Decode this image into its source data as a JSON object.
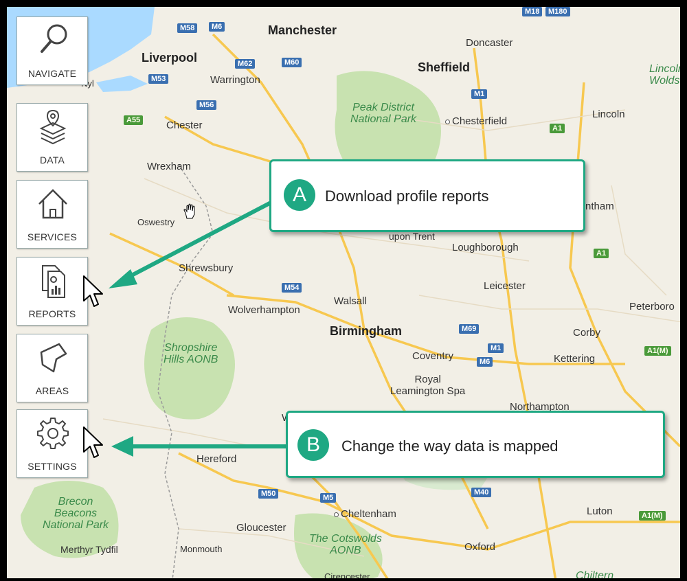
{
  "sidebar": {
    "items": [
      {
        "label": "NAVIGATE",
        "icon": "magnifier-icon"
      },
      {
        "label": "DATA",
        "icon": "layers-pin-icon"
      },
      {
        "label": "SERVICES",
        "icon": "house-icon"
      },
      {
        "label": "REPORTS",
        "icon": "report-document-icon"
      },
      {
        "label": "AREAS",
        "icon": "polygon-icon"
      },
      {
        "label": "SETTINGS",
        "icon": "gear-icon"
      }
    ]
  },
  "callouts": {
    "a": {
      "badge": "A",
      "text": "Download profile reports"
    },
    "b": {
      "badge": "B",
      "text": "Change the way data is mapped"
    }
  },
  "map": {
    "places": {
      "manchester": "Manchester",
      "liverpool": "Liverpool",
      "warrington": "Warrington",
      "doncaster": "Doncaster",
      "sheffield": "Sheffield",
      "lincoln": "Lincoln",
      "lincoln_wolds": "Lincoln\nWolds",
      "chester": "Chester",
      "chesterfield": "Chesterfield",
      "peak_district": "Peak District\nNational Park",
      "wrexham": "Wrexham",
      "oswestry": "Oswestry",
      "grantham": "ntham",
      "upon_trent": "upon Trent",
      "loughborough": "Loughborough",
      "shrewsbury": "Shrewsbury",
      "leicester": "Leicester",
      "walsall": "Walsall",
      "wolverhampton": "Wolverhampton",
      "peterborough": "Peterboro",
      "birmingham": "Birmingham",
      "corby": "Corby",
      "shropshire_hills": "Shropshire\nHills AONB",
      "coventry": "Coventry",
      "kettering": "Kettering",
      "royal_leamington": "Royal\nLeamington Spa",
      "northampton": "Northampton",
      "hereford": "Hereford",
      "brecon": "Brecon\nBeacons\nNational Park",
      "cheltenham": "Cheltenham",
      "luton": "Luton",
      "gloucester": "Gloucester",
      "cotswolds": "The Cotswolds\nAONB",
      "oxford": "Oxford",
      "merthyr": "Merthyr Tydfil",
      "monmouth": "Monmouth",
      "cirencester": "Cirencester",
      "chiltern": "Chiltern",
      "nyl": "Nyl",
      "w": "W"
    },
    "roads": {
      "m58": "M58",
      "m6a": "M6",
      "m62": "M62",
      "m60": "M60",
      "m53": "M53",
      "m56": "M56",
      "a55": "A55",
      "m1a": "M1",
      "a1a": "A1",
      "a1b": "A1",
      "m54": "M54",
      "m69": "M69",
      "m1b": "M1",
      "m6b": "M6",
      "a1m": "A1(M)",
      "m50": "M50",
      "m5": "M5",
      "m40": "M40",
      "a1m2": "A1(M)",
      "m180": "M180",
      "m18": "M18"
    }
  },
  "colors": {
    "accent": "#1fa883",
    "water": "#aadaff",
    "park": "#c8e2b0",
    "road_major": "#f7c850",
    "motorway_shield": "#3a6fb0"
  }
}
